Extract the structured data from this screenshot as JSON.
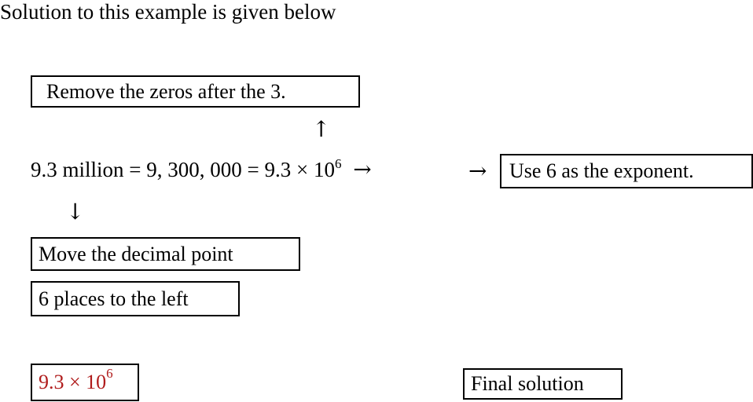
{
  "intro": "Solution to this example is given below",
  "boxes": {
    "remove_zeros": "Remove the zeros after the 3.",
    "use_exponent": "Use 6 as the exponent.",
    "move_decimal_line1": "Move the decimal point",
    "move_decimal_line2": "6 places to the left",
    "final_label": "Final solution"
  },
  "equation": {
    "part1": "9.3 million = 9, 300, 000 = 9.3 × 10",
    "exponent": "6",
    "arrow_after": "→"
  },
  "arrows": {
    "up": "↑",
    "down": "↓",
    "right_to_box": "→"
  },
  "answer": {
    "base": "9.3 × 10",
    "exponent": "6",
    "color": "#b01c1c"
  }
}
